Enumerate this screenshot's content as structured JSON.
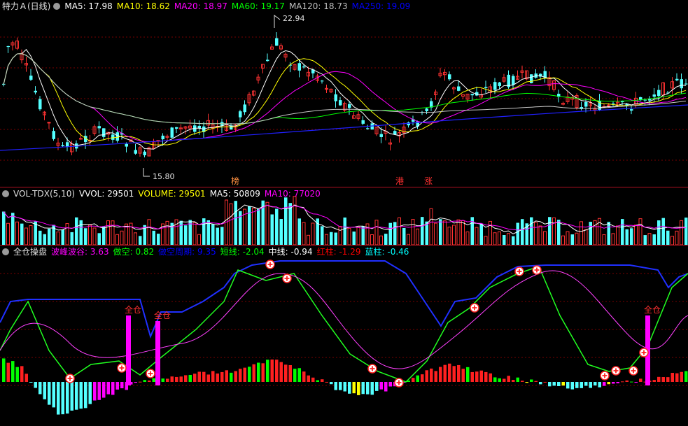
{
  "main": {
    "title": "特力Ａ(日线)",
    "ma_labels": [
      {
        "text": "MA5: 17.98",
        "color": "#ffffff"
      },
      {
        "text": "MA10: 18.62",
        "color": "#ffff00"
      },
      {
        "text": "MA20: 18.97",
        "color": "#ff00ff"
      },
      {
        "text": "MA60: 19.17",
        "color": "#00ff00"
      },
      {
        "text": "MA120: 18.73",
        "color": "#c0c0c0"
      },
      {
        "text": "MA250: 19.09",
        "color": "#0000ff"
      }
    ],
    "high_label": "22.94",
    "low_label": "15.80",
    "events": [
      "榜",
      "港",
      "涨"
    ]
  },
  "volume": {
    "title": "VOL-TDX(5,10)",
    "labels": [
      {
        "text": "VVOL: 29501",
        "color": "#ffffff"
      },
      {
        "text": "VOLUME: 29501",
        "color": "#ffff00"
      },
      {
        "text": "MA5: 50809",
        "color": "#ffffff"
      },
      {
        "text": "MA10: 77020",
        "color": "#ff00ff"
      }
    ]
  },
  "indicator": {
    "title": "全仓操盘",
    "labels": [
      {
        "text": "波峰波谷: 3.63",
        "color": "#ff00ff"
      },
      {
        "text": "做空: 0.82",
        "color": "#00ff00"
      },
      {
        "text": "做空周期: 9.35",
        "color": "#0000ff"
      },
      {
        "text": "短线: -2.04",
        "color": "#00ff00"
      },
      {
        "text": "中线: -0.94",
        "color": "#ffffff"
      },
      {
        "text": "红柱: -1.29",
        "color": "#ff0000"
      },
      {
        "text": "蓝柱: -0.46",
        "color": "#00ffff"
      }
    ],
    "signal_label": "全仓"
  },
  "colors": {
    "up": "#ff3232",
    "down": "#54ffff",
    "grid": "#7a0000"
  }
}
